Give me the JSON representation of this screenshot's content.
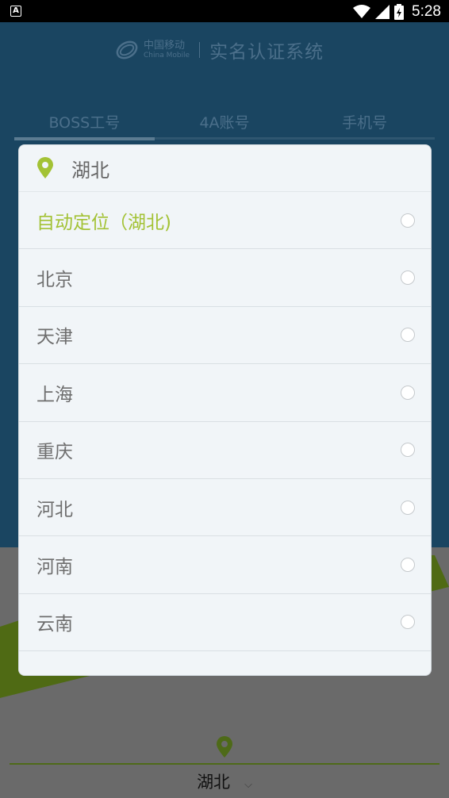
{
  "status_bar": {
    "notification_badge": "A",
    "time": "5:28"
  },
  "header": {
    "logo_cn": "中国移动",
    "logo_en": "China Mobile",
    "title": "实名认证系统"
  },
  "tabs": [
    "BOSS工号",
    "4A账号",
    "手机号"
  ],
  "bottom": {
    "city": "湖北",
    "chevron": "⌵"
  },
  "dialog": {
    "title": "湖北",
    "options": [
      {
        "label": "自动定位（湖北)",
        "selected": true
      },
      {
        "label": "北京"
      },
      {
        "label": "天津"
      },
      {
        "label": "上海"
      },
      {
        "label": "重庆"
      },
      {
        "label": "河北"
      },
      {
        "label": "河南"
      },
      {
        "label": "云南"
      }
    ]
  },
  "colors": {
    "accent": "#a3c235",
    "header_bg": "#1a4561"
  }
}
